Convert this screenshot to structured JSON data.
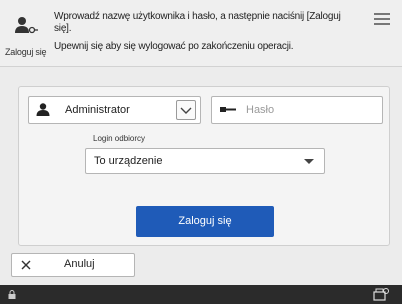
{
  "header": {
    "login_label": "Zaloguj się",
    "message_line1": "Wprowadź nazwę użytkownika i hasło, a następnie naciśnij [Zaloguj się].",
    "message_line2": "Upewnij się aby się wylogować po zakończeniu operacji.",
    "user_icon": "user-key-icon",
    "menu_icon": "menu-icon"
  },
  "form": {
    "user_select": {
      "value": "Administrator",
      "icon": "user-icon",
      "dropdown_icon": "chevron-down-icon"
    },
    "password": {
      "placeholder": "Hasło",
      "icon": "key-icon"
    },
    "target_label": "Login odbiorcy",
    "target_select": {
      "value": "To urządzenie",
      "icon": "caret-down-icon"
    },
    "login_button": "Zaloguj się"
  },
  "footer": {
    "cancel_button": "Anuluj",
    "left_icon": "lock-icon",
    "right_icon": "device-status-icon"
  },
  "colors": {
    "accent": "#1f5bb8",
    "footer_bg": "#2b2b2b"
  }
}
